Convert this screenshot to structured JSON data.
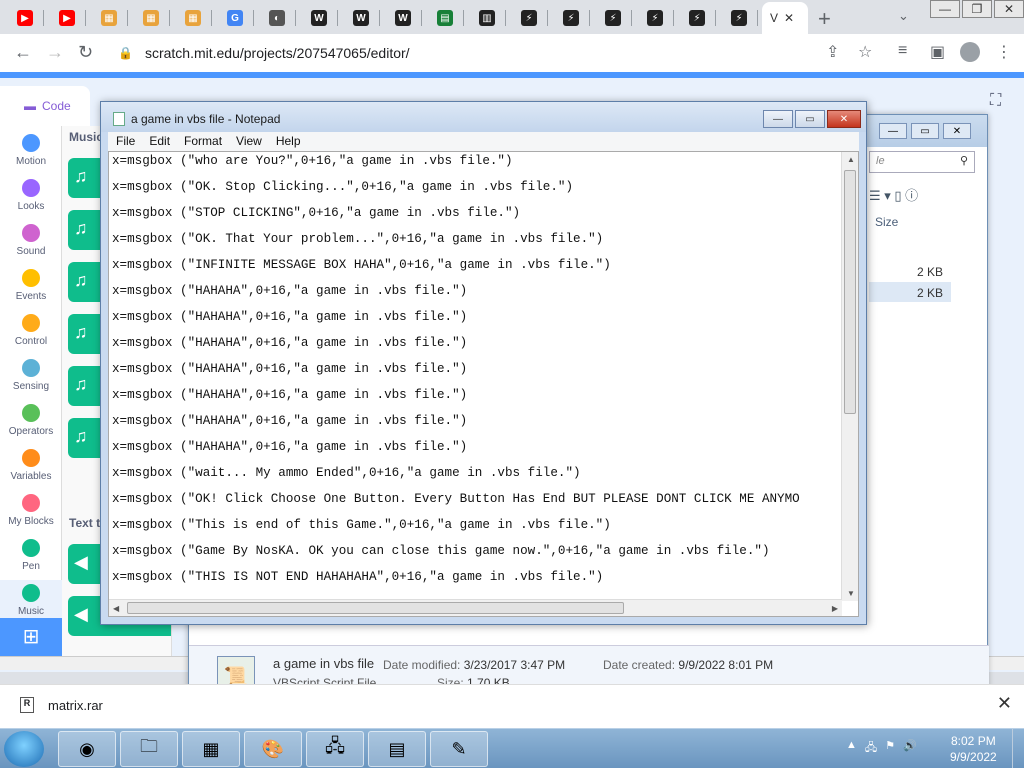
{
  "browser": {
    "active_tab_label": "V",
    "url": "scratch.mit.edu/projects/207547065/editor/",
    "tabs": [
      {
        "icon": "youtube-icon",
        "color": "#ff0000",
        "glyph": "▶"
      },
      {
        "icon": "youtube-icon",
        "color": "#ff0000",
        "glyph": "▶"
      },
      {
        "icon": "scratch-icon",
        "color": "#e8a33c",
        "glyph": "▦"
      },
      {
        "icon": "scratch-icon",
        "color": "#e8a33c",
        "glyph": "▦"
      },
      {
        "icon": "scratch-icon",
        "color": "#e8a33c",
        "glyph": "▦"
      },
      {
        "icon": "google-icon",
        "color": "#4285f4",
        "glyph": "G"
      },
      {
        "icon": "globe-icon",
        "color": "#555555",
        "glyph": "◐"
      },
      {
        "icon": "wikipedia-icon",
        "color": "#222222",
        "glyph": "W"
      },
      {
        "icon": "wikipedia-icon",
        "color": "#222222",
        "glyph": "W"
      },
      {
        "icon": "wikipedia-icon",
        "color": "#222222",
        "glyph": "W"
      },
      {
        "icon": "sheets-icon",
        "color": "#188038",
        "glyph": "▤"
      },
      {
        "icon": "archive-icon",
        "color": "#222222",
        "glyph": "▥"
      },
      {
        "icon": "site-icon",
        "color": "#222222",
        "glyph": "⚡"
      },
      {
        "icon": "site-icon",
        "color": "#222222",
        "glyph": "⚡"
      },
      {
        "icon": "site-icon",
        "color": "#222222",
        "glyph": "⚡"
      },
      {
        "icon": "site-icon",
        "color": "#222222",
        "glyph": "⚡"
      },
      {
        "icon": "site-icon",
        "color": "#222222",
        "glyph": "⚡"
      },
      {
        "icon": "site-icon",
        "color": "#222222",
        "glyph": "⚡"
      }
    ]
  },
  "scratch": {
    "code_tab": "Code",
    "categories": [
      {
        "label": "Motion",
        "color": "#4c97ff"
      },
      {
        "label": "Looks",
        "color": "#9966ff"
      },
      {
        "label": "Sound",
        "color": "#cf63cf"
      },
      {
        "label": "Events",
        "color": "#ffbf00"
      },
      {
        "label": "Control",
        "color": "#ffab19"
      },
      {
        "label": "Sensing",
        "color": "#5cb1d6"
      },
      {
        "label": "Operators",
        "color": "#59c059"
      },
      {
        "label": "Variables",
        "color": "#ff8c1a"
      },
      {
        "label": "My Blocks",
        "color": "#ff6680"
      },
      {
        "label": "Pen",
        "color": "#0fbd8c"
      },
      {
        "label": "Music",
        "color": "#0fbd8c"
      }
    ],
    "palette_heading_music": "Music",
    "palette_heading_text": "Text t"
  },
  "explorer": {
    "search_placeholder": "le",
    "col_size": "Size",
    "sizes": [
      "2 KB",
      "2 KB"
    ],
    "details": {
      "file_name": "a game in vbs file",
      "file_type": "VBScript Script File",
      "modified_label": "Date modified:",
      "modified_value": "3/23/2017 3:47 PM",
      "created_label": "Date created:",
      "created_value": "9/9/2022 8:01 PM",
      "size_label": "Size:",
      "size_value": "1.70 KB"
    }
  },
  "notepad": {
    "title": "a game in vbs file - Notepad",
    "menu": [
      "File",
      "Edit",
      "Format",
      "View",
      "Help"
    ],
    "lines": [
      "x=msgbox (\"who are You?\",0+16,\"a game in .vbs file.\")",
      "x=msgbox (\"OK. Stop Clicking...\",0+16,\"a game in .vbs file.\")",
      "x=msgbox (\"STOP CLICKING\",0+16,\"a game in .vbs file.\")",
      "x=msgbox (\"OK. That Your problem...\",0+16,\"a game in .vbs file.\")",
      "x=msgbox (\"INFINITE MESSAGE BOX HAHA\",0+16,\"a game in .vbs file.\")",
      "x=msgbox (\"HAHAHA\",0+16,\"a game in .vbs file.\")",
      "x=msgbox (\"HAHAHA\",0+16,\"a game in .vbs file.\")",
      "x=msgbox (\"HAHAHA\",0+16,\"a game in .vbs file.\")",
      "x=msgbox (\"HAHAHA\",0+16,\"a game in .vbs file.\")",
      "x=msgbox (\"HAHAHA\",0+16,\"a game in .vbs file.\")",
      "x=msgbox (\"HAHAHA\",0+16,\"a game in .vbs file.\")",
      "x=msgbox (\"HAHAHA\",0+16,\"a game in .vbs file.\")",
      "x=msgbox (\"wait... My ammo Ended\",0+16,\"a game in .vbs file.\")",
      "x=msgbox (\"OK! Click Choose One Button. Every Button Has End BUT PLEASE DONT CLICK ME ANYMO",
      "x=msgbox (\"This is end of this Game.\",0+16,\"a game in .vbs file.\")",
      "x=msgbox (\"Game By NosKA. OK you can close this game now.\",0+16,\"a game in .vbs file.\")",
      "x=msgbox (\"THIS IS NOT END HAHAHAHA\",0+16,\"a game in .vbs file.\")"
    ]
  },
  "download": {
    "file": "matrix.rar"
  },
  "taskbar": {
    "time": "8:02 PM",
    "date": "9/9/2022"
  }
}
